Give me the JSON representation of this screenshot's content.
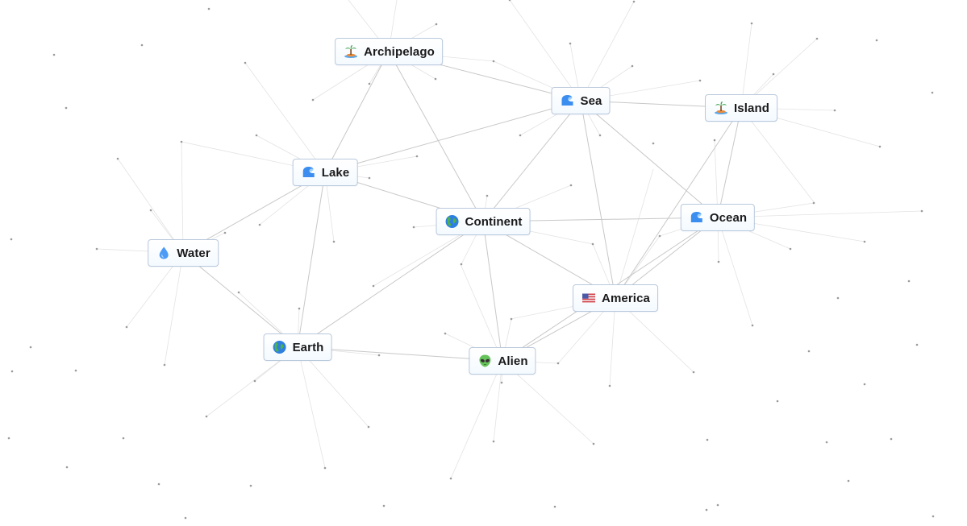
{
  "app": {
    "name": "Infinite Craft graph view"
  },
  "colors": {
    "edge": "#c8c8c8",
    "edge_faint": "#e3e3e3",
    "dot": "#9a9a9a",
    "node_border": "#b9c9dd",
    "node_bg_top": "#ffffff",
    "node_bg_bottom": "#f4faff",
    "text": "#1a1a1a"
  },
  "nodes": [
    {
      "id": "archipelago",
      "label": "Archipelago",
      "icon": "desert-island-icon",
      "emoji": "🏝️"
    },
    {
      "id": "sea",
      "label": "Sea",
      "icon": "wave-icon",
      "emoji": "🌊"
    },
    {
      "id": "island",
      "label": "Island",
      "icon": "desert-island-icon",
      "emoji": "🏝️"
    },
    {
      "id": "lake",
      "label": "Lake",
      "icon": "wave-icon",
      "emoji": "🌊"
    },
    {
      "id": "continent",
      "label": "Continent",
      "icon": "globe-americas-icon",
      "emoji": "🌎"
    },
    {
      "id": "ocean",
      "label": "Ocean",
      "icon": "wave-icon",
      "emoji": "🌊"
    },
    {
      "id": "water",
      "label": "Water",
      "icon": "droplet-icon",
      "emoji": "💧"
    },
    {
      "id": "america",
      "label": "America",
      "icon": "us-flag-icon",
      "emoji": "🇺🇸"
    },
    {
      "id": "earth",
      "label": "Earth",
      "icon": "globe-icon",
      "emoji": "🌍"
    },
    {
      "id": "alien",
      "label": "Alien",
      "icon": "alien-icon",
      "emoji": "👽"
    }
  ],
  "edges": [
    [
      "archipelago",
      "sea"
    ],
    [
      "archipelago",
      "lake"
    ],
    [
      "archipelago",
      "continent"
    ],
    [
      "sea",
      "island"
    ],
    [
      "sea",
      "continent"
    ],
    [
      "sea",
      "ocean"
    ],
    [
      "sea",
      "america"
    ],
    [
      "sea",
      "lake"
    ],
    [
      "island",
      "ocean"
    ],
    [
      "island",
      "america"
    ],
    [
      "lake",
      "continent"
    ],
    [
      "lake",
      "water"
    ],
    [
      "lake",
      "earth"
    ],
    [
      "continent",
      "alien"
    ],
    [
      "continent",
      "america"
    ],
    [
      "continent",
      "earth"
    ],
    [
      "continent",
      "ocean"
    ],
    [
      "ocean",
      "america"
    ],
    [
      "ocean",
      "alien"
    ],
    [
      "water",
      "earth"
    ],
    [
      "earth",
      "alien"
    ],
    [
      "america",
      "alien"
    ]
  ]
}
